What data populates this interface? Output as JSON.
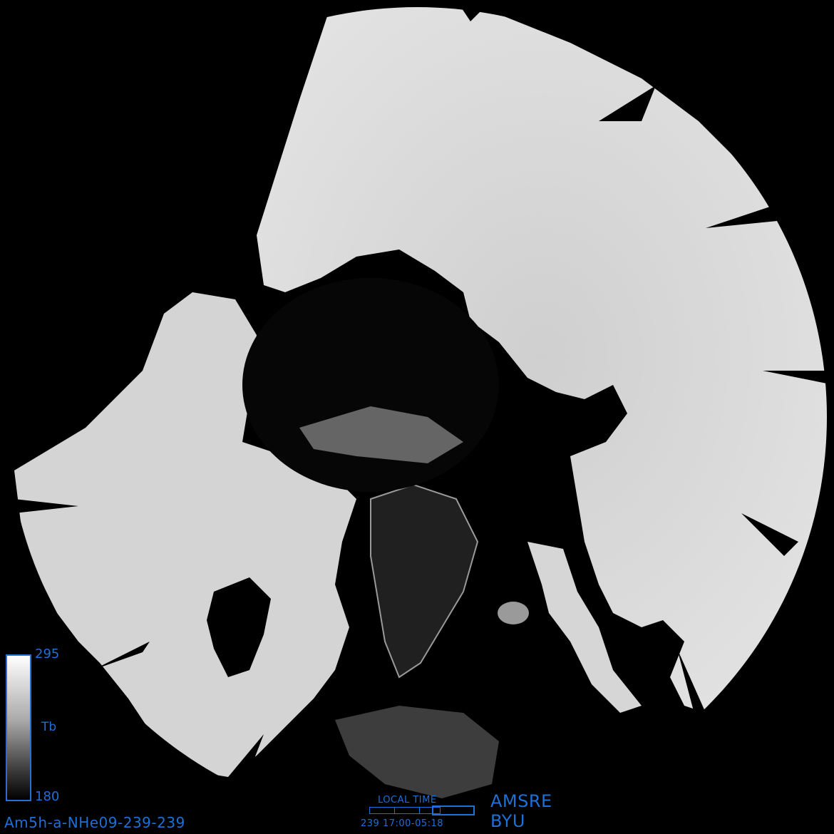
{
  "colorbar": {
    "max_label": "295",
    "min_label": "180",
    "quantity_label": "Tb"
  },
  "product_id": "Am5h-a-NHe09-239-239",
  "local_time": {
    "label": "LOCAL TIME",
    "value": "239 17:00-05:18"
  },
  "sensor": "AMSRE",
  "organization": "BYU",
  "colors": {
    "background": "#000000",
    "land": "#d8d8d8",
    "annotation": "#1e6fd6"
  }
}
